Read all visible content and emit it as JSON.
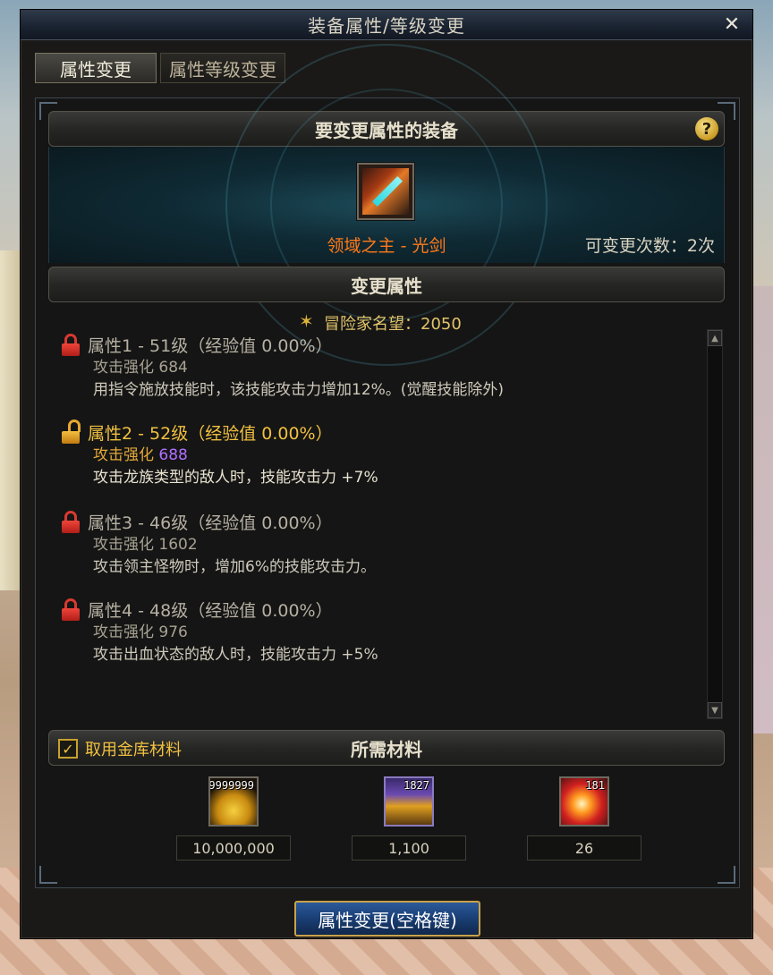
{
  "window": {
    "title": "装备属性/等级变更",
    "close_symbol": "✕"
  },
  "tabs": [
    {
      "label": "属性变更",
      "active": true
    },
    {
      "label": "属性等级变更",
      "active": false
    }
  ],
  "equipment": {
    "section_title": "要变更属性的装备",
    "help_symbol": "?",
    "item_name": "领域之主 - 光剑",
    "item_icon": "lightsaber-icon",
    "change_count": "可变更次数：2次"
  },
  "attributes": {
    "section_title": "变更属性",
    "fame": "冒险家名望：2050",
    "items": [
      {
        "title": "属性1 - 51级（经验值 0.00%）",
        "locked": true,
        "enhance_label": "攻击强化",
        "enhance_value": "684",
        "effect": "用指令施放技能时，该技能攻击力增加12%。(觉醒技能除外)"
      },
      {
        "title": "属性2 - 52级（经验值 0.00%）",
        "locked": false,
        "enhance_label": "攻击强化",
        "enhance_value": "688",
        "effect": "攻击龙族类型的敌人时，技能攻击力 +7%"
      },
      {
        "title": "属性3 - 46级（经验值 0.00%）",
        "locked": true,
        "enhance_label": "攻击强化",
        "enhance_value": "1602",
        "effect": "攻击领主怪物时，增加6%的技能攻击力。"
      },
      {
        "title": "属性4 - 48级（经验值 0.00%）",
        "locked": true,
        "enhance_label": "攻击强化",
        "enhance_value": "976",
        "effect": "攻击出血状态的敌人时，技能攻击力 +5%"
      }
    ]
  },
  "materials": {
    "section_title": "所需材料",
    "vault_checkbox_label": "取用金库材料",
    "vault_checked": true,
    "items": [
      {
        "icon": "gold-coins-icon",
        "count": "9999999",
        "required": "10,000,000"
      },
      {
        "icon": "crystal-icon",
        "count": "1827",
        "required": "1,100"
      },
      {
        "icon": "burst-orb-icon",
        "count": "181",
        "required": "26"
      }
    ]
  },
  "action_button_label": "属性变更(空格键)",
  "colors": {
    "item_name": "#ff7a1a",
    "unlocked_attr": "#f0c040",
    "enhance_highlight": "#b070ff",
    "button_blue": "#1a3e74"
  }
}
